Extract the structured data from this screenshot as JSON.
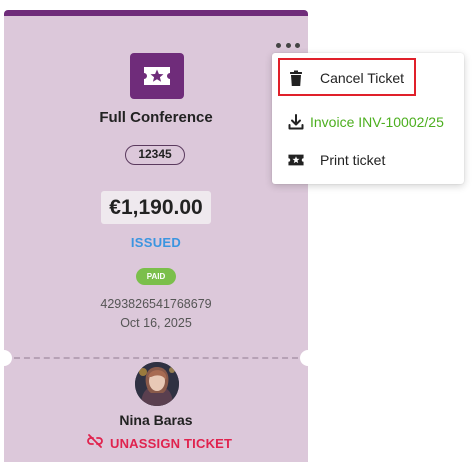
{
  "ticket": {
    "name": "Full Conference",
    "code": "12345",
    "price": "€1,190.00",
    "status": "ISSUED",
    "payment_badge": "PAID",
    "number": "4293826541768679",
    "date": "Oct 16, 2025",
    "holder_name": "Nina Baras",
    "unassign_label": "UNASSIGN TICKET",
    "icon": "ticket-star-icon"
  },
  "menu": {
    "items": [
      {
        "label": "Cancel Ticket",
        "icon": "trash-icon",
        "color": "#222222"
      },
      {
        "label": "Invoice INV-10002/25",
        "icon": "download-icon",
        "color": "#4caf1f"
      },
      {
        "label": "Print ticket",
        "icon": "ticket-star-icon",
        "color": "#222222"
      }
    ]
  },
  "colors": {
    "ticket_background": "#dcc8da",
    "ticket_accent": "#6f2c7a",
    "status_issued": "#3b95e0",
    "badge_paid": "#7bbf4b",
    "unassign": "#e0234e",
    "invoice_link": "#4caf1f",
    "highlight_box": "#e0202a"
  }
}
